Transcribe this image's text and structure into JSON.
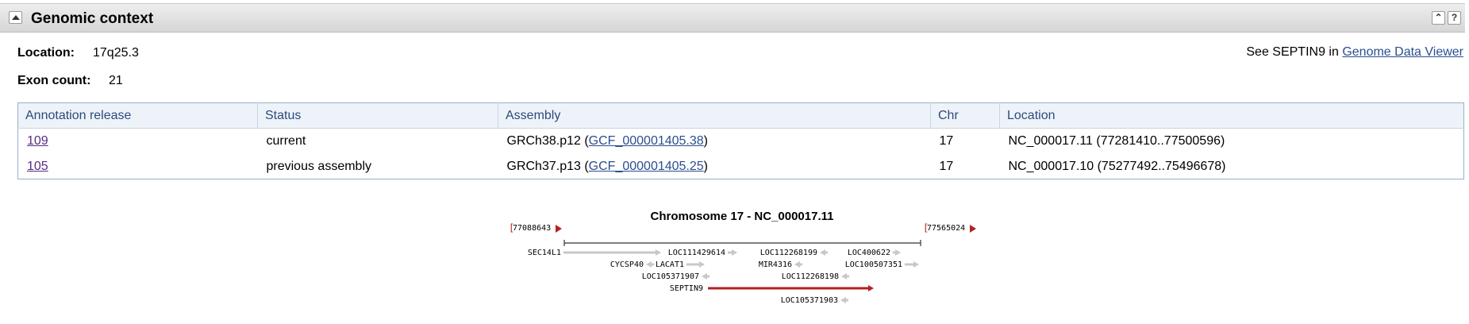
{
  "panel": {
    "title": "Genomic context"
  },
  "summary": {
    "location_label": "Location:",
    "location_value": "17q25.3",
    "exon_label": "Exon count:",
    "exon_value": "21",
    "see_prefix": "See SEPTIN9 in",
    "see_link": "Genome Data Viewer"
  },
  "table": {
    "headers": [
      "Annotation release",
      "Status",
      "Assembly",
      "Chr",
      "Location"
    ],
    "rows": [
      {
        "release": "109",
        "status": "current",
        "assembly_name": "GRCh38.p12",
        "assembly_accession": "GCF_000001405.38",
        "chr": "17",
        "location": "NC_000017.11 (77281410..77500596)"
      },
      {
        "release": "105",
        "status": "previous assembly",
        "assembly_name": "GRCh37.p13",
        "assembly_accession": "GCF_000001405.25",
        "chr": "17",
        "location": "NC_000017.10 (75277492..75496678)"
      }
    ]
  },
  "graphic": {
    "title": "Chromosome 17 - NC_000017.11",
    "start_coord": "77088643",
    "end_coord": "77565024",
    "highlight_color": "#b22222",
    "gene_color": "#c8c8c8",
    "genes": [
      {
        "name": "SEC14L1",
        "strand": "+",
        "highlight": false
      },
      {
        "name": "LOC111429614",
        "strand": "+",
        "highlight": false
      },
      {
        "name": "LOC112268199",
        "strand": "-",
        "highlight": false
      },
      {
        "name": "LOC400622",
        "strand": "+",
        "highlight": false
      },
      {
        "name": "CYCSP40",
        "strand": "-",
        "highlight": false
      },
      {
        "name": "LACAT1",
        "strand": "+",
        "highlight": false
      },
      {
        "name": "MIR4316",
        "strand": "-",
        "highlight": false
      },
      {
        "name": "LOC100507351",
        "strand": "+",
        "highlight": false
      },
      {
        "name": "LOC105371907",
        "strand": "-",
        "highlight": false
      },
      {
        "name": "LOC112268198",
        "strand": "-",
        "highlight": false
      },
      {
        "name": "SEPTIN9",
        "strand": "+",
        "highlight": true
      },
      {
        "name": "LOC105371903",
        "strand": "-",
        "highlight": false
      }
    ]
  }
}
